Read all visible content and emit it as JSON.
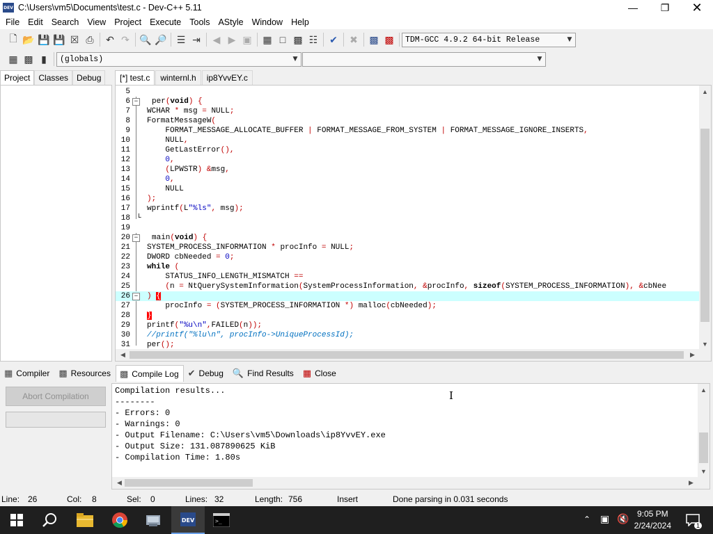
{
  "window": {
    "title": "C:\\Users\\vm5\\Documents\\test.c - Dev-C++ 5.11",
    "app_icon_text": "DEV"
  },
  "menu": [
    "File",
    "Edit",
    "Search",
    "View",
    "Project",
    "Execute",
    "Tools",
    "AStyle",
    "Window",
    "Help"
  ],
  "toolbar": {
    "compiler_select": "TDM-GCC 4.9.2 64-bit Release",
    "scope_select": "(globals)",
    "member_select": ""
  },
  "left_tabs": [
    "Project",
    "Classes",
    "Debug"
  ],
  "editor_tabs": [
    "[*] test.c",
    "winternl.h",
    "ip8YvvEY.c"
  ],
  "editor": {
    "line_numbers": [
      "5",
      "6",
      "7",
      "8",
      "9",
      "10",
      "11",
      "12",
      "13",
      "14",
      "15",
      "16",
      "17",
      "18",
      "19",
      "20",
      "21",
      "22",
      "23",
      "24",
      "25",
      "26",
      "27",
      "28",
      "29",
      "30",
      "31"
    ],
    "current_line": "26"
  },
  "bottom_tabs": [
    "Compiler",
    "Resources",
    "Compile Log",
    "Debug",
    "Find Results",
    "Close"
  ],
  "compile": {
    "abort_label": "Abort Compilation",
    "log": [
      "Compilation results...",
      "--------",
      "- Errors: 0",
      "- Warnings: 0",
      "- Output Filename: C:\\Users\\vm5\\Downloads\\ip8YvvEY.exe",
      "- Output Size: 131.087890625 KiB",
      "- Compilation Time: 1.80s"
    ]
  },
  "status": {
    "line_label": "Line:",
    "line_value": "26",
    "col_label": "Col:",
    "col_value": "8",
    "sel_label": "Sel:",
    "sel_value": "0",
    "lines_label": "Lines:",
    "lines_value": "32",
    "length_label": "Length:",
    "length_value": "756",
    "mode": "Insert",
    "message": "Done parsing in 0.031 seconds"
  },
  "taskbar": {
    "time": "9:05 PM",
    "date": "2/24/2024",
    "notification_count": "1"
  }
}
